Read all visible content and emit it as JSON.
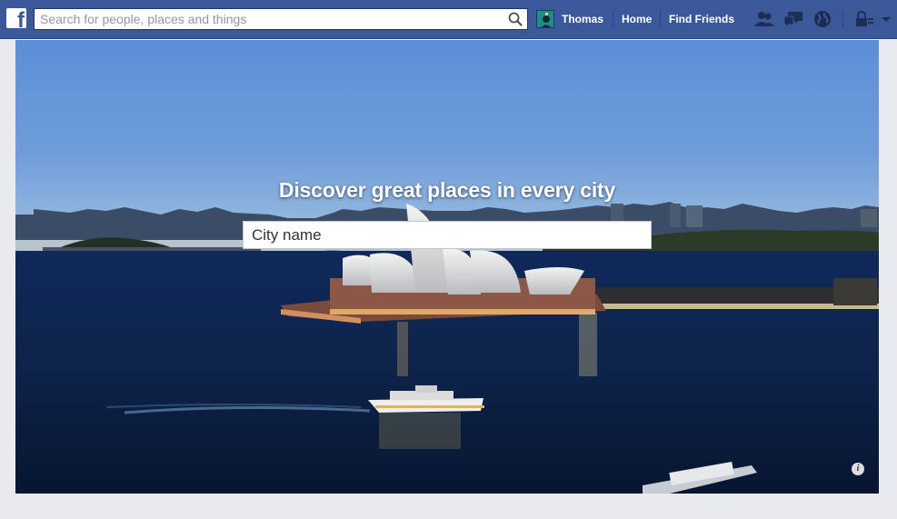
{
  "topbar": {
    "logo_icon": "facebook-logo-icon",
    "search": {
      "placeholder": "Search for people, places and things",
      "value": ""
    },
    "profile_name": "Thomas",
    "nav": {
      "home": "Home",
      "find_friends": "Find Friends"
    },
    "icons": [
      "friend-requests-icon",
      "messages-icon",
      "notifications-globe-icon",
      "privacy-lock-icon",
      "account-dropdown-icon"
    ],
    "brand_color": "#3b5998"
  },
  "hero": {
    "title": "Discover great places in every city",
    "city_input": {
      "placeholder": "City name",
      "value": ""
    },
    "info_icon": "i"
  }
}
